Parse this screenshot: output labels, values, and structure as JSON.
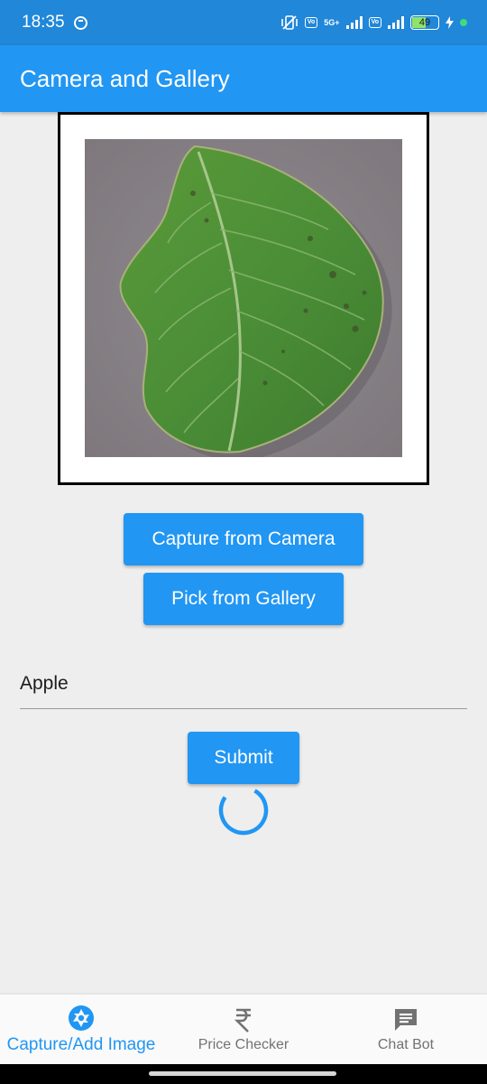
{
  "status_bar": {
    "time": "18:35",
    "network_badge_1": "Vo\nWiFi",
    "network_type": "5G+",
    "network_badge_2": "Vo\nLTE",
    "battery_level": 49
  },
  "app_bar": {
    "title": "Camera and Gallery"
  },
  "image_preview": {
    "icon": "leaf-image"
  },
  "buttons": {
    "capture_camera": "Capture from Camera",
    "pick_gallery": "Pick from Gallery",
    "submit": "Submit"
  },
  "input": {
    "value": "Apple"
  },
  "bottom_nav": {
    "items": [
      {
        "label": "Capture/Add Image",
        "icon": "camera-shutter-icon",
        "active": true
      },
      {
        "label": "Price Checker",
        "icon": "rupee-icon",
        "active": false
      },
      {
        "label": "Chat Bot",
        "icon": "chat-icon",
        "active": false
      }
    ]
  },
  "colors": {
    "primary": "#2196f3",
    "status_bar": "#2087d9",
    "background": "#eeeeee"
  }
}
